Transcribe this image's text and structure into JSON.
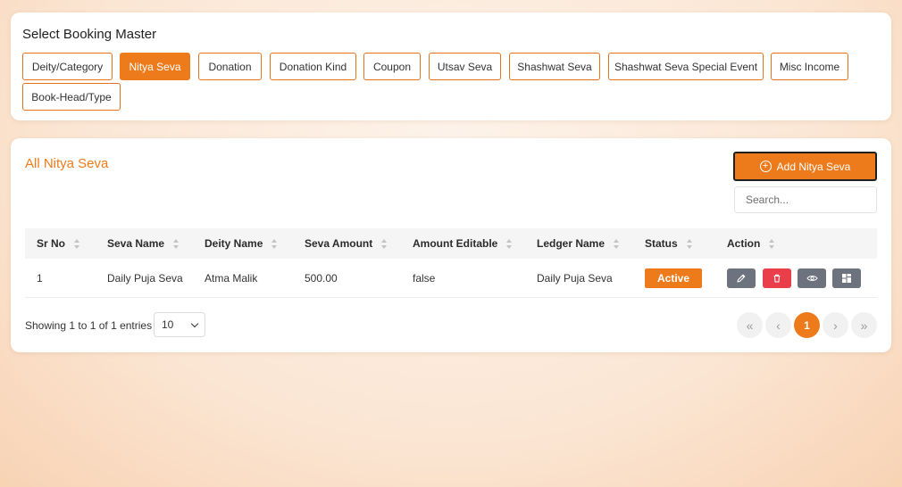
{
  "booking_master": {
    "title": "Select Booking Master",
    "options": [
      {
        "label": "Deity/Category",
        "active": false
      },
      {
        "label": "Nitya Seva",
        "active": true
      },
      {
        "label": "Donation",
        "active": false
      },
      {
        "label": "Donation Kind",
        "active": false
      },
      {
        "label": "Coupon",
        "active": false
      },
      {
        "label": "Utsav Seva",
        "active": false
      },
      {
        "label": "Shashwat Seva",
        "active": false
      },
      {
        "label": "Shashwat Seva Special Event",
        "active": false
      },
      {
        "label": "Misc Income",
        "active": false
      },
      {
        "label": "Book-Head/Type",
        "active": false
      }
    ]
  },
  "list": {
    "title": "All Nitya Seva",
    "add_button_label": "Add Nitya Seva",
    "search_placeholder": "Search...",
    "columns": [
      "Sr No",
      "Seva Name",
      "Deity Name",
      "Seva Amount",
      "Amount Editable",
      "Ledger Name",
      "Status",
      "Action"
    ],
    "rows": [
      {
        "sr_no": "1",
        "seva_name": "Daily Puja Seva",
        "deity_name": "Atma Malik",
        "seva_amount": "500.00",
        "amount_editable": "false",
        "ledger_name": "Daily Puja Seva",
        "status": "Active"
      }
    ],
    "actions": [
      "pencil-icon",
      "trash-icon",
      "eye-icon",
      "grid-icon"
    ],
    "entries_info": "Showing 1 to 1 of 1 entries",
    "page_size": "10",
    "pagination": {
      "first": "«",
      "prev": "‹",
      "current": "1",
      "next": "›",
      "last": "»"
    }
  },
  "colors": {
    "accent": "#ee7b1b",
    "danger": "#ea3f4b",
    "neutral_button": "#6c727e"
  }
}
